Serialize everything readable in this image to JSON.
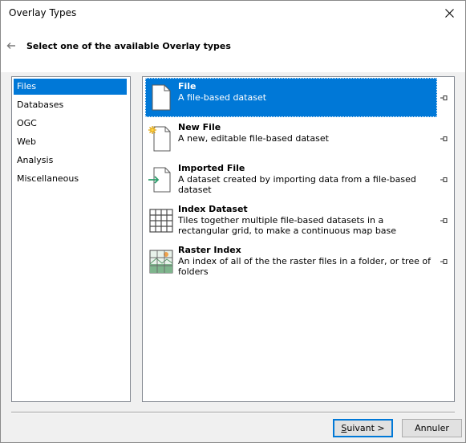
{
  "window": {
    "title": "Overlay Types"
  },
  "header": {
    "instruction": "Select one of the available Overlay types"
  },
  "categories": [
    {
      "label": "Files",
      "selected": true
    },
    {
      "label": "Databases",
      "selected": false
    },
    {
      "label": "OGC",
      "selected": false
    },
    {
      "label": "Web",
      "selected": false
    },
    {
      "label": "Analysis",
      "selected": false
    },
    {
      "label": "Miscellaneous",
      "selected": false
    }
  ],
  "overlay_types": [
    {
      "title": "File",
      "description": "A file-based dataset",
      "icon": "document-icon",
      "selected": true
    },
    {
      "title": "New File",
      "description": "A new, editable file-based dataset",
      "icon": "new-document-icon",
      "selected": false
    },
    {
      "title": "Imported File",
      "description": "A dataset created by importing data from a file-based dataset",
      "icon": "import-document-icon",
      "selected": false
    },
    {
      "title": "Index Dataset",
      "description": "Tiles together multiple file-based datasets in a rectangular grid, to make a continuous map base",
      "icon": "grid-icon",
      "selected": false
    },
    {
      "title": "Raster Index",
      "description": "An index of all of the the raster files in a folder, or tree of folders",
      "icon": "raster-index-icon",
      "selected": false
    }
  ],
  "buttons": {
    "next_first_letter": "S",
    "next_rest": "uivant >",
    "cancel": "Annuler"
  },
  "colors": {
    "selection": "#0078d7",
    "background": "#f0f0f0"
  }
}
